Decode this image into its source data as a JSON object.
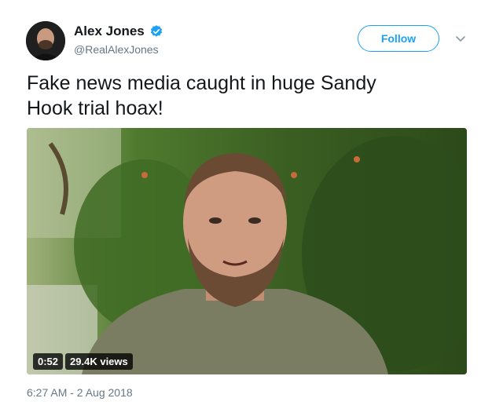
{
  "tweet": {
    "display_name": "Alex Jones",
    "handle": "@RealAlexJones",
    "verified": true,
    "follow_label": "Follow",
    "text": "Fake news media caught in huge Sandy\nHook trial hoax!",
    "timestamp": "6:27 AM - 2 Aug 2018"
  },
  "video": {
    "duration": "0:52",
    "views": "29.4K views"
  },
  "colors": {
    "accent": "#1da1f2",
    "secondary_text": "#657786",
    "primary_text": "#14171a"
  },
  "icons": {
    "verified": "verified-badge-icon",
    "caret": "chevron-down-icon"
  }
}
